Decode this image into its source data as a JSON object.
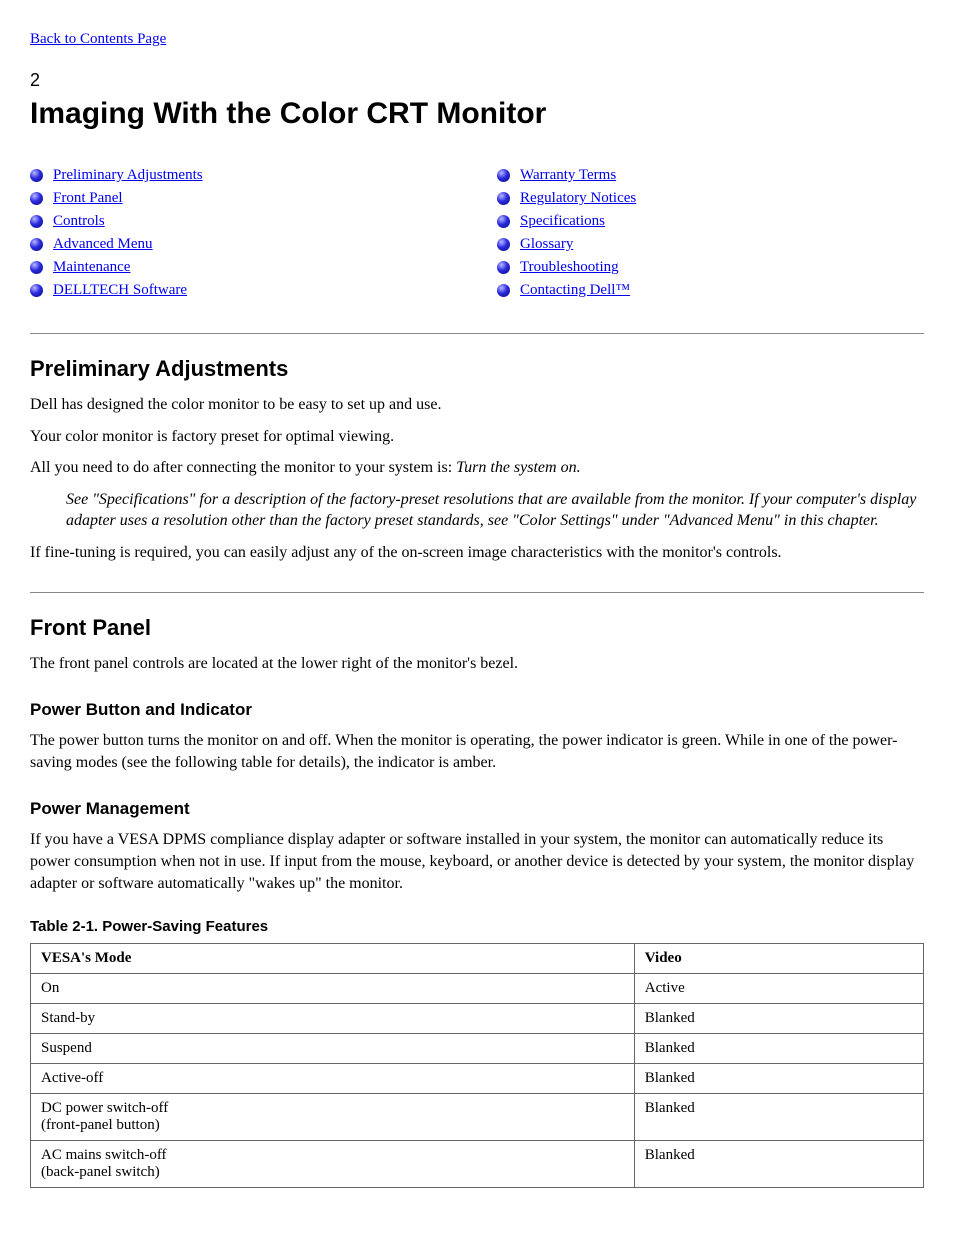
{
  "backLink": "Back to Contents Page",
  "chapterNum": "2",
  "chapterTitle": "Imaging With the Color CRT Monitor",
  "toc": {
    "left": [
      "Preliminary Adjustments",
      "Front Panel",
      "Controls",
      "Advanced Menu",
      "Maintenance",
      "DELLTECH Software"
    ],
    "right": [
      "Warranty Terms",
      "Regulatory Notices",
      "Specifications",
      "Glossary",
      "Troubleshooting",
      "Contacting Dell™"
    ]
  },
  "prelim": {
    "heading": "Preliminary Adjustments",
    "p1": "Dell has designed the color monitor to be easy to set up and use.",
    "p2": "Your color monitor is factory preset for optimal viewing.",
    "p3prefix": "All you need to do after connecting the monitor to your system is:",
    "p3step": "Turn the system on.",
    "note": "See \"Specifications\" for a description of the factory-preset resolutions that are available from the monitor. If your computer's display adapter uses a resolution other than the factory preset standards, see \"Color Settings\" under \"Advanced Menu\" in this chapter.",
    "p5": "If fine-tuning is required, you can easily adjust any of the on-screen image characteristics with the monitor's controls."
  },
  "sec2": {
    "heading": "Front Panel",
    "p1": "The front panel controls are located at the lower right of the monitor's bezel.",
    "power": {
      "heading": "Power Button and Indicator",
      "p1": "The power button turns the monitor on and off. When the monitor is operating, the power indicator is green. While in one of the power-saving modes (see the following table for details), the indicator is amber."
    },
    "pm": {
      "heading": "Power Management",
      "p1": "If you have a VESA DPMS compliance display adapter or software installed in your system, the monitor can automatically reduce its power consumption when not in use. If input from the mouse, keyboard, or another device is detected by your system, the monitor display adapter or software automatically \"wakes up\" the monitor."
    }
  },
  "table": {
    "caption": "Table 2-1. Power-Saving Features",
    "headers": [
      "VESA's Mode",
      "Video"
    ],
    "rows": [
      [
        "On",
        "Active"
      ],
      [
        "Stand-by",
        "Blanked"
      ],
      [
        "Suspend",
        "Blanked"
      ],
      [
        "Active-off",
        "Blanked"
      ],
      [
        "DC power switch-off\n(front-panel button)",
        "Blanked"
      ],
      [
        "AC mains switch-off\n(back-panel switch)",
        "Blanked"
      ]
    ]
  }
}
